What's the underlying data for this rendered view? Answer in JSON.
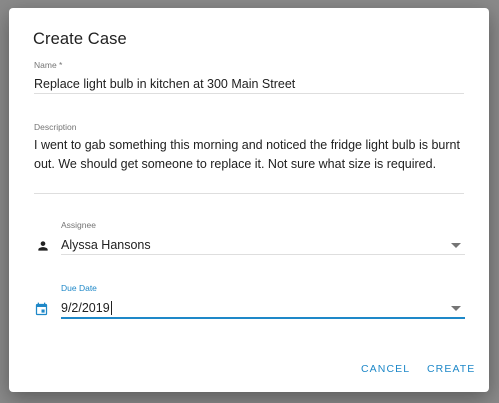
{
  "dialog": {
    "title": "Create Case",
    "name": {
      "label": "Name *",
      "value": "Replace light bulb in kitchen at 300 Main Street"
    },
    "description": {
      "label": "Description",
      "value": "I went to gab something this morning and noticed the fridge light bulb is burnt out. We should get someone to replace it. Not sure what size is required."
    },
    "assignee": {
      "label": "Assignee",
      "value": "Alyssa Hansons",
      "icon": "person-icon"
    },
    "due_date": {
      "label": "Due Date",
      "value": "9/2/2019",
      "icon": "calendar-icon"
    },
    "actions": {
      "cancel_label": "CANCEL",
      "create_label": "CREATE"
    }
  },
  "colors": {
    "accent": "#1e88c8",
    "text": "#212121",
    "label": "#757575"
  }
}
